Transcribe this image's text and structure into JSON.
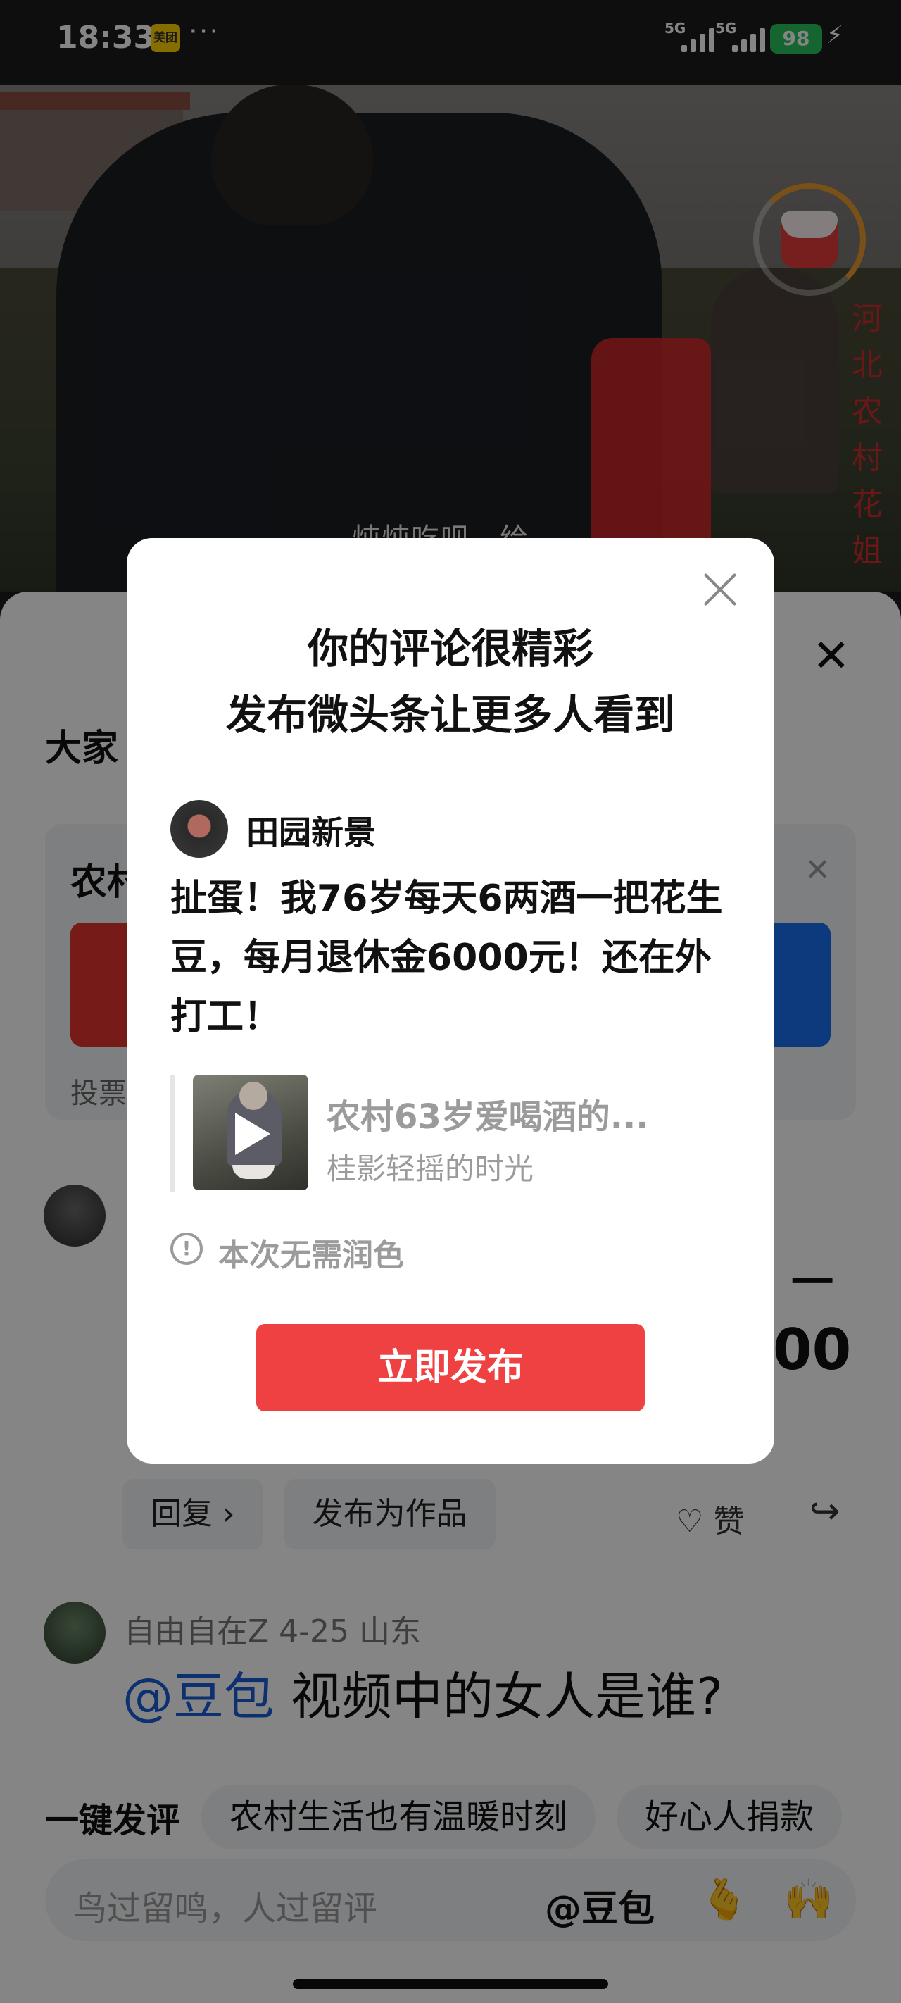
{
  "status_bar": {
    "time": "18:33",
    "app_badge": "美团",
    "more": "···",
    "net1": "5G",
    "net2": "5G",
    "battery": "98",
    "charging_icon": "bolt-icon"
  },
  "video": {
    "subtitle": "炖炖吃呗，给",
    "watermark": "河北农村花姐",
    "redpack_icon": "red-envelope-icon"
  },
  "sheet": {
    "header": "大家",
    "vote_title": "农村",
    "vote_footer": "投票",
    "comment1_partial_right": "00",
    "comment1_partial_top": "一",
    "actions": {
      "reply": "回复 ›",
      "publish_as_work": "发布为作品",
      "like": "赞"
    },
    "comment2": {
      "meta": "自由自在Z  4-25  山东",
      "mention": "@豆包",
      "text": " 视频中的女人是谁?"
    },
    "quick_comments": {
      "label": "一键发评",
      "chips": [
        "农村生活也有温暖时刻",
        "好心人捐款"
      ]
    },
    "input": {
      "placeholder": "鸟过留鸣，人过留评",
      "mention": "@豆包",
      "emoji1": "🫰",
      "emoji2": "🙌"
    }
  },
  "modal": {
    "title_line1": "你的评论很精彩",
    "title_line2": "发布微头条让更多人看到",
    "username": "田园新景",
    "body": "扯蛋！我76岁每天6两酒一把花生豆，每月退休金6000元！还在外打工！",
    "ref_title": "农村63岁爱喝酒的...",
    "ref_author": "桂影轻摇的时光",
    "note_icon": "!",
    "note": "本次无需润色",
    "publish_button": "立即发布"
  },
  "colors": {
    "accent_red": "#f04142",
    "mention_blue": "#1a5fd6",
    "battery_green": "#29c15c"
  }
}
